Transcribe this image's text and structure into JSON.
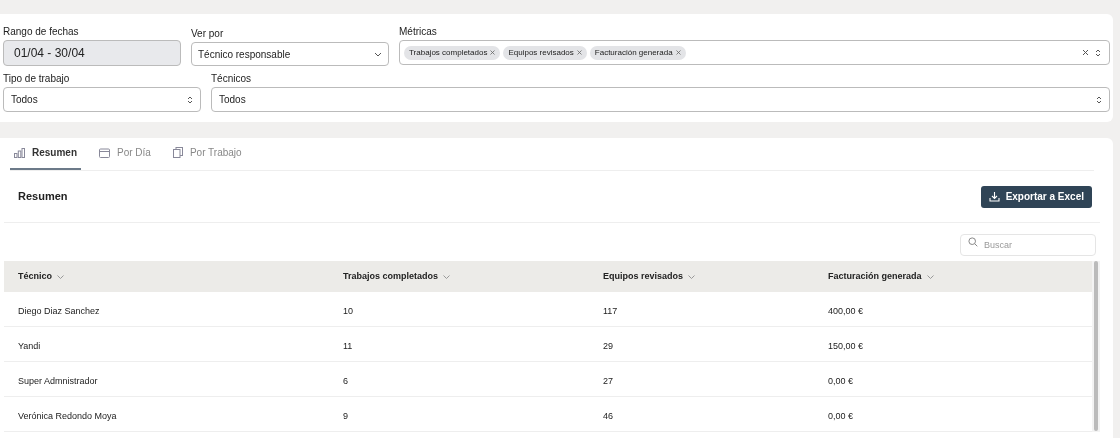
{
  "filters": {
    "date_range": {
      "label": "Rango de fechas",
      "value": "01/04 - 30/04"
    },
    "view_by": {
      "label": "Ver por",
      "value": "Técnico responsable"
    },
    "metrics": {
      "label": "Métricas",
      "tags": [
        "Trabajos completados",
        "Equipos revisados",
        "Facturación generada"
      ]
    },
    "job_type": {
      "label": "Tipo de trabajo",
      "value": "Todos"
    },
    "technicians": {
      "label": "Técnicos",
      "value": "Todos"
    }
  },
  "tabs": [
    {
      "label": "Resumen",
      "kind": "chart",
      "selected": true
    },
    {
      "label": "Por Día",
      "kind": "calendar",
      "selected": false
    },
    {
      "label": "Por Trabajo",
      "kind": "files",
      "selected": false
    }
  ],
  "section": {
    "title": "Resumen",
    "export_button": "Exportar a Excel",
    "search": {
      "placeholder": "Buscar"
    }
  },
  "table": {
    "columns": [
      "Técnico",
      "Trabajos completados",
      "Equipos revisados",
      "Facturación generada"
    ],
    "rows": [
      [
        "Diego Diaz Sanchez",
        "10",
        "117",
        "400,00 €"
      ],
      [
        "Yandi",
        "11",
        "29",
        "150,00 €"
      ],
      [
        "Super Admnistrador",
        "6",
        "27",
        "0,00 €"
      ],
      [
        "Verónica Redondo Moya",
        "9",
        "46",
        "0,00 €"
      ]
    ]
  }
}
